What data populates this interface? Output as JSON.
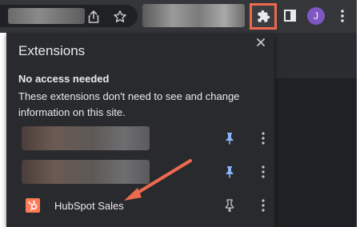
{
  "toolbar": {
    "avatar_initial": "J",
    "icons": [
      "share-icon",
      "star-icon",
      "puzzle-icon",
      "side-panel-icon",
      "more-vert-icon"
    ]
  },
  "popup": {
    "title": "Extensions",
    "section_title": "No access needed",
    "section_description": "These extensions don't need to see and change information on this site.",
    "extensions": [
      {
        "name": "",
        "pinned": true
      },
      {
        "name": "",
        "pinned": true
      },
      {
        "name": "HubSpot Sales",
        "pinned": false
      }
    ]
  },
  "colors": {
    "highlight": "#ee6a4f",
    "pin_active": "#8ab4f8",
    "avatar": "#7f57c2",
    "hubspot": "#ff7a59",
    "popup_bg": "#292a2d"
  }
}
